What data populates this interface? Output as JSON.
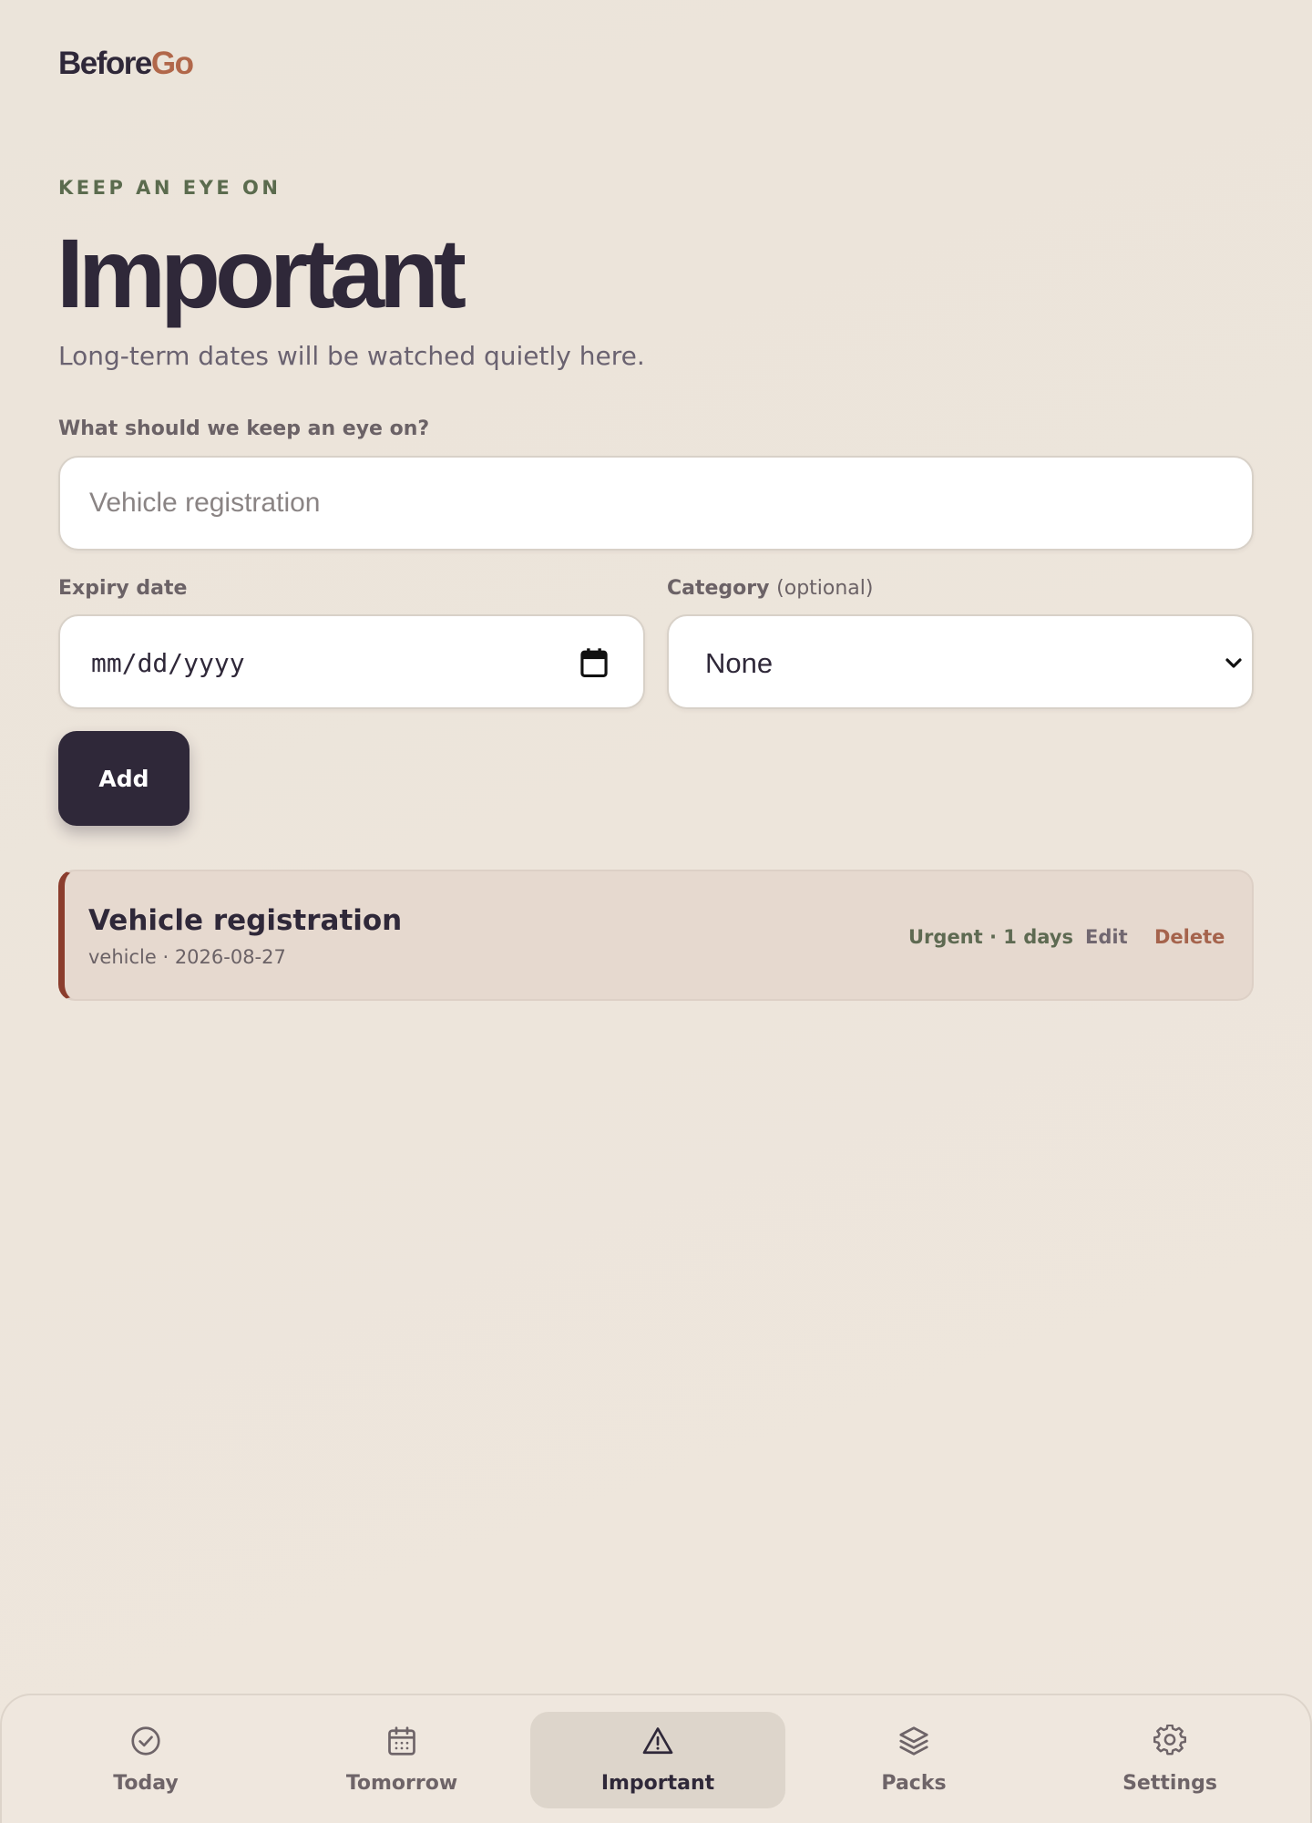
{
  "brand": {
    "part1": "Before",
    "part2": "Go"
  },
  "header": {
    "eyebrow": "KEEP AN EYE ON",
    "title": "Important",
    "subtitle": "Long-term dates will be watched quietly here."
  },
  "form": {
    "what_label": "What should we keep an eye on?",
    "what_placeholder": "Vehicle registration",
    "what_value": "",
    "expiry_label": "Expiry date",
    "expiry_placeholder": "mm/dd/yyyy",
    "category_label": "Category",
    "category_optional": "(optional)",
    "category_value": "None",
    "add_label": "Add"
  },
  "items": [
    {
      "title": "Vehicle registration",
      "meta": "vehicle · 2026-08-27",
      "status": "Urgent · 1 days",
      "edit_label": "Edit",
      "delete_label": "Delete",
      "accent": "#8b3d2d"
    }
  ],
  "nav": [
    {
      "label": "Today",
      "icon": "check-circle-icon",
      "active": false
    },
    {
      "label": "Tomorrow",
      "icon": "calendar-icon",
      "active": false
    },
    {
      "label": "Important",
      "icon": "warning-triangle-icon",
      "active": true
    },
    {
      "label": "Packs",
      "icon": "layers-icon",
      "active": false
    },
    {
      "label": "Settings",
      "icon": "gear-icon",
      "active": false
    }
  ],
  "colors": {
    "ink": "#2f2839",
    "brand_accent": "#b1674a",
    "eyebrow": "#5b6b4e",
    "urgent_accent": "#8b3d2d",
    "delete": "#a5634c"
  }
}
